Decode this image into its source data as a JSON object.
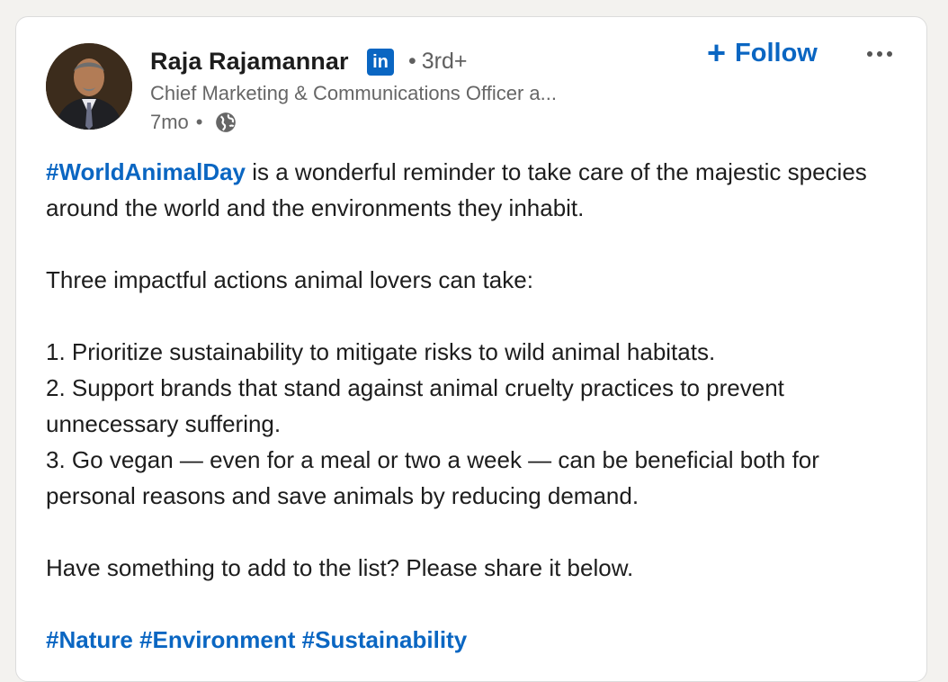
{
  "author": {
    "name": "Raja Rajamannar",
    "badge": "in",
    "degree": "3rd+",
    "degree_dot": "•",
    "headline": "Chief Marketing & Communications Officer a...",
    "time": "7mo",
    "time_dot": "•",
    "visibility_icon": "globe-icon"
  },
  "actions": {
    "follow_plus": "+",
    "follow_label": "Follow",
    "more_icon": "more-options-icon"
  },
  "post": {
    "hashtag_lead": "#WorldAnimalDay",
    "line1_rest": " is a wonderful reminder to take care of the majestic species around the world and the environments they inhabit.",
    "intro": "Three impactful actions animal lovers can take:",
    "items": [
      "1. Prioritize sustainability to mitigate risks to wild animal habitats.",
      "2. Support brands that stand against animal cruelty practices to prevent unnecessary suffering.",
      "3. Go vegan — even for a meal or two a week — can be beneficial both for personal reasons and save animals by reducing demand."
    ],
    "cta": "Have something to add to the list? Please share it below.",
    "hashtags": [
      "#Nature",
      "#Environment",
      "#Sustainability"
    ]
  },
  "colors": {
    "link_blue": "#0a66c2",
    "text": "#1d1d1d",
    "muted": "#666666"
  }
}
